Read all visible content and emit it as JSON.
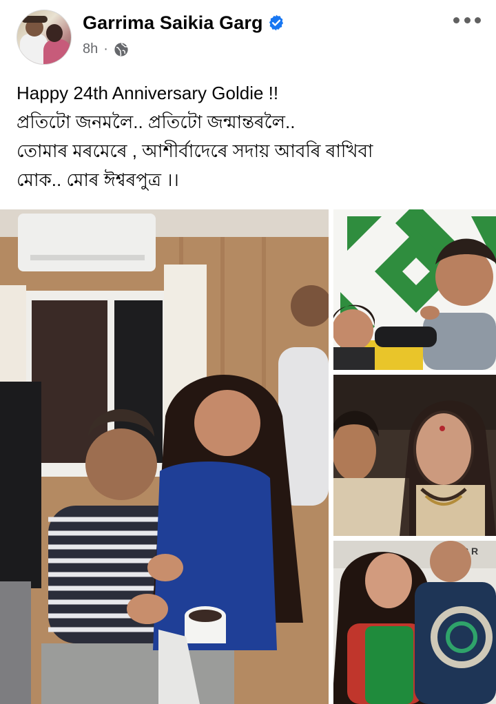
{
  "post": {
    "author": "Garrima Saikia Garg",
    "time": "8h",
    "separator": "·",
    "privacy_icon": "globe-icon",
    "verified_icon": "verified-badge-icon",
    "more_icon": "more-options-icon",
    "text_lines": [
      "Happy 24th Anniversary Goldie !!",
      "প্ৰতিটো জনমলৈ.. প্ৰতিটো জন্মান্তৰলৈ..",
      "তোমাৰ মৰমেৰে , আশীৰ্বাদেৰে সদায় আবৰি ৰাখিবা",
      "মোক.. মোৰ ঈশ্বৰপুত্ৰ ।।"
    ]
  },
  "colors": {
    "verified": "#1877f2",
    "meta_text": "#65676b",
    "text": "#050505"
  },
  "photos": {
    "count": 4,
    "watermark_text": "C R"
  }
}
